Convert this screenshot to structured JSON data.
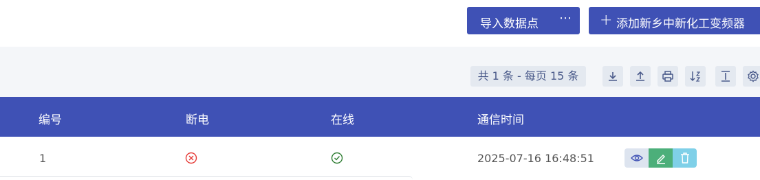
{
  "header": {
    "import_label": "导入数据点",
    "more_label": "⋯",
    "add_icon": "plus-icon",
    "add_label": "添加新乡中新化工变频器"
  },
  "toolbar": {
    "pager_text": "共 1 条 - 每页 15 条",
    "icons": [
      "download-icon",
      "upload-icon",
      "print-icon",
      "sort-icon",
      "column-height-icon",
      "settings-icon"
    ]
  },
  "table": {
    "headers": [
      "编号",
      "断电",
      "在线",
      "通信时间"
    ],
    "rows": [
      {
        "id": "1",
        "power_off": "error-circle-icon",
        "online": "check-circle-icon",
        "comm_time": "2025-07-16 16:48:51",
        "actions": [
          "eye-icon",
          "edit-icon",
          "delete-icon"
        ]
      }
    ]
  },
  "colors": {
    "primary": "#3f51b5",
    "toolbar_bg": "#f4f6f9",
    "error": "#e53935",
    "success": "#2e7d32",
    "edit": "#4caf7a",
    "delete": "#7fd0e8"
  }
}
